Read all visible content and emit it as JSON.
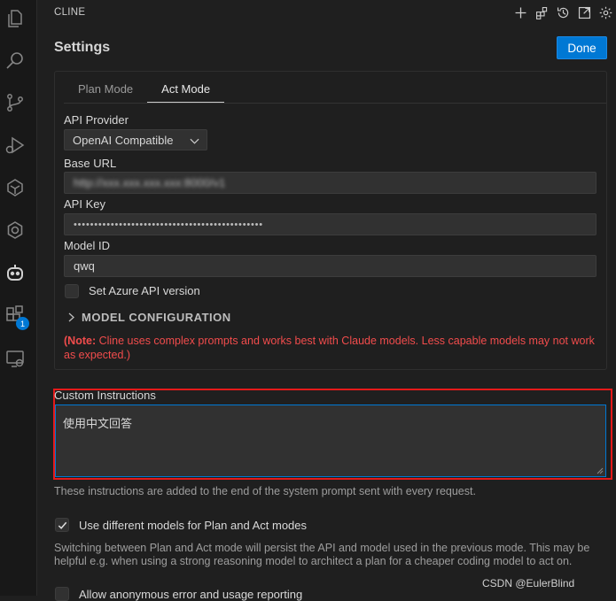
{
  "activity_bar": {
    "items": [
      {
        "name": "explorer-icon"
      },
      {
        "name": "search-icon"
      },
      {
        "name": "source-control-icon"
      },
      {
        "name": "run-debug-icon"
      },
      {
        "name": "ai-assistant-icon"
      },
      {
        "name": "ai-chat-icon"
      },
      {
        "name": "cline-robot-icon"
      },
      {
        "name": "extensions-icon"
      },
      {
        "name": "remote-explorer-icon"
      }
    ],
    "extensions_badge": "1"
  },
  "header": {
    "panel_title": "CLINE",
    "icons": [
      "plus-icon",
      "mcp-servers-icon",
      "history-icon",
      "open-in-editor-icon",
      "gear-icon"
    ]
  },
  "settings": {
    "title": "Settings",
    "done_label": "Done",
    "tabs": [
      {
        "label": "Plan Mode",
        "active": false
      },
      {
        "label": "Act Mode",
        "active": true
      }
    ],
    "api_provider_label": "API Provider",
    "api_provider_value": "OpenAI Compatible",
    "base_url_label": "Base URL",
    "base_url_value": "http://xxx.xxx.xxx.xxx:8000/v1",
    "api_key_label": "API Key",
    "api_key_value": "••••••••••••••••••••••••••••••••••••••••••••••",
    "model_id_label": "Model ID",
    "model_id_value": "qwq",
    "azure_checkbox_label": "Set Azure API version",
    "model_config_label": "MODEL CONFIGURATION",
    "note_prefix": "(Note:",
    "note_text": " Cline uses complex prompts and works best with Claude models. Less capable models may not work as expected.)",
    "custom_instructions_label": "Custom Instructions",
    "custom_instructions_value": "使用中文回答",
    "custom_instructions_help": "These instructions are added to the end of the system prompt sent with every request.",
    "plan_act_checkbox_label": "Use different models for Plan and Act modes",
    "plan_act_checked": true,
    "plan_act_help": "Switching between Plan and Act mode will persist the API and model used in the previous mode. This may be helpful e.g. when using a strong reasoning model to architect a plan for a cheaper coding model to act on.",
    "telemetry_checkbox_label": "Allow anonymous error and usage reporting"
  },
  "watermark": "CSDN @EulerBlind",
  "colors": {
    "accent": "#0078d4",
    "highlight_outline": "#e51a1a",
    "warning_text": "#f14c4c"
  }
}
